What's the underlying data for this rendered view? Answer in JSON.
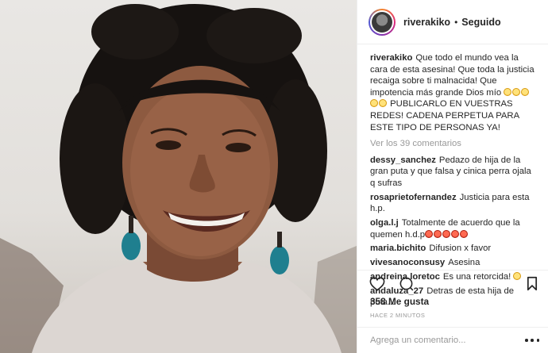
{
  "header": {
    "username": "riverakiko",
    "separator": "•",
    "follow_status": "Seguido"
  },
  "caption": {
    "username": "riverakiko",
    "text": "Que todo el mundo vea la cara de esta asesina! Que toda la justicia recaiga sobre ti malnacida! Que impotencia más grande Dios mío",
    "emoji": "sad-face x5",
    "text2": "PUBLICARLO EN VUESTRAS REDES! CADENA PERPETUA PARA ESTE TIPO DE PERSONAS YA!"
  },
  "view_all": "Ver los 39 comentarios",
  "comments": [
    {
      "username": "dessy_sanchez",
      "text": "Pedazo de hija de la gran puta y que falsa y cinica perra ojala q sufras"
    },
    {
      "username": "rosaprietofernandez",
      "text": "Justicia para esta h.p."
    },
    {
      "username": "olga.l.j",
      "text": "Totalmente de acuerdo que la quemen h.d.p",
      "emoji": "angry-face x5"
    },
    {
      "username": "maria.bichito",
      "text": "Difusion x favor"
    },
    {
      "username": "vivesanoconsusy",
      "text": "Asesina"
    },
    {
      "username": "andreina.loretoc",
      "text": "Es una retorcida!",
      "emoji": "sad-face"
    },
    {
      "username": "andaluza_27",
      "text": "Detras de esta hija de puta..."
    }
  ],
  "likes": "358 Me gusta",
  "timestamp": "HACE 2 MINUTOS",
  "add_comment": {
    "placeholder": "Agrega un comentario..."
  },
  "icons": {
    "like": "heart-icon",
    "comment": "comment-bubble-icon",
    "save": "bookmark-icon",
    "more": "more-options-icon"
  },
  "colors": {
    "text": "#262626",
    "muted": "#999999",
    "divider": "#efefef",
    "story_ring": "#dd2a7b"
  }
}
